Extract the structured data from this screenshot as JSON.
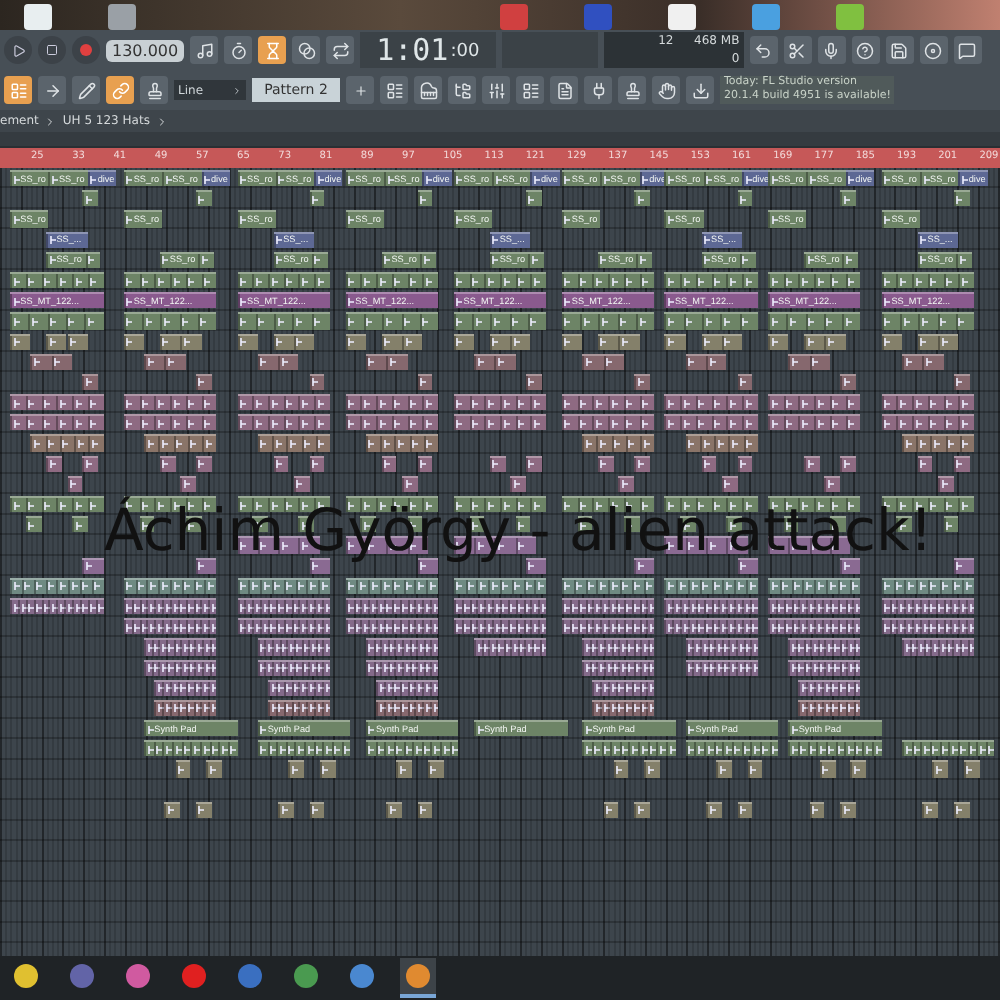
{
  "toolbar": {
    "tempo": "130.000",
    "time_main": "1:01",
    "time_sub": ":00",
    "cpu": "12",
    "memory": "468 MB",
    "polyphony": "0",
    "mode_buttons": [
      {
        "kind": "metronome",
        "selected": false
      },
      {
        "kind": "wait",
        "selected": false
      },
      {
        "kind": "countdown",
        "selected": true
      },
      {
        "kind": "blend",
        "selected": false
      },
      {
        "kind": "loop",
        "selected": false
      }
    ],
    "tool_buttons": [
      {
        "kind": "pattern",
        "selected": true
      },
      {
        "kind": "arrow",
        "selected": false
      },
      {
        "kind": "pencil",
        "selected": false
      },
      {
        "kind": "link",
        "selected": true
      },
      {
        "kind": "stamp",
        "selected": false
      }
    ],
    "snap": "Line",
    "pattern": "Pattern 2",
    "hint": [
      "Today: FL Studio version",
      "20.1.4 build 4951 is available!"
    ]
  },
  "breadcrumb": [
    "ement",
    "UH 5 123 Hats"
  ],
  "ruler": [
    "25",
    "33",
    "41",
    "49",
    "57",
    "65",
    "73",
    "81",
    "89",
    "97",
    "105",
    "113",
    "121",
    "129",
    "137",
    "145",
    "153",
    "161",
    "169",
    "177",
    "185",
    "193",
    "201",
    "209"
  ],
  "lanes": [
    {
      "clips": [
        {
          "label": "SS_ro"
        },
        {
          "label": "SS_ro"
        },
        {
          "label": "dive"
        },
        {
          "label": "SS_ro"
        },
        {
          "label": "SS_ro"
        },
        {
          "label": "dive"
        },
        {
          "label": "SS_ro"
        },
        {
          "label": "SS_ro"
        },
        {
          "label": "dive"
        },
        {
          "label": "SS_ro"
        },
        {
          "label": "SS_ro"
        },
        {
          "label": "dive"
        },
        {
          "label": "SS_ro"
        },
        {
          "label": "SS_ro"
        },
        {
          "label": "dive"
        },
        {
          "label": "SS_ro"
        },
        {
          "label": "SS_ro"
        },
        {
          "label": "dive"
        },
        {
          "label": "SS_ro"
        },
        {
          "label": "SS_ro"
        },
        {
          "label": "dive"
        },
        {
          "label": "SS_ro"
        },
        {
          "label": "SS_ro"
        },
        {
          "label": "dive"
        },
        {
          "label": "SS_ro"
        },
        {
          "label": "SS_ro"
        },
        {
          "label": "dive"
        }
      ]
    },
    {
      "clips": [
        {
          "label": "SS_ro"
        },
        {
          "label": "SS_ro"
        },
        {
          "label": "SS_ro"
        },
        {
          "label": "SS_ro"
        },
        {
          "label": "SS_ro"
        },
        {
          "label": "SS_ro"
        },
        {
          "label": "SS_ro"
        },
        {
          "label": "SS_ro"
        },
        {
          "label": "SS_ro"
        }
      ]
    },
    {
      "clips": [
        {
          "label": "SS_..."
        },
        {
          "label": "SS_..."
        },
        {
          "label": "SS_..."
        },
        {
          "label": "SS_..."
        },
        {
          "label": "SS_..."
        }
      ]
    },
    {
      "clips": [
        {
          "label": "SS_ro"
        },
        {
          "label": "SS_ro"
        },
        {
          "label": "SS_ro"
        },
        {
          "label": "SS_ro"
        },
        {
          "label": "SS_ro"
        },
        {
          "label": "SS_ro"
        },
        {
          "label": "SS_ro"
        },
        {
          "label": "SS_ro"
        },
        {
          "label": "SS_ro"
        }
      ]
    },
    {
      "clips": [
        {
          "label": "SS_MT_122..."
        },
        {
          "label": "SS_MT_122..."
        },
        {
          "label": "SS_MT_122..."
        },
        {
          "label": "SS_MT_122..."
        },
        {
          "label": "SS_MT_122..."
        },
        {
          "label": "SS_MT_122..."
        },
        {
          "label": "SS_MT_122..."
        },
        {
          "label": "SS_MT_122..."
        },
        {
          "label": "SS_MT_122..."
        }
      ]
    },
    {
      "clips": [
        {
          "label": "Synth Pad"
        },
        {
          "label": "Synth Pad"
        },
        {
          "label": "Synth Pad"
        },
        {
          "label": "Synth Pad"
        },
        {
          "label": "Synth Pad"
        },
        {
          "label": "Synth Pad"
        },
        {
          "label": "Synth Pad"
        }
      ]
    }
  ],
  "overlay_title": "Áchim György - alien attack!",
  "taskbar": [
    {
      "kind": "chrome",
      "selected": false
    },
    {
      "kind": "teams",
      "selected": false
    },
    {
      "kind": "drop",
      "selected": false
    },
    {
      "kind": "opera",
      "selected": false
    },
    {
      "kind": "doc",
      "selected": false
    },
    {
      "kind": "sheet",
      "selected": false
    },
    {
      "kind": "globe",
      "selected": false
    },
    {
      "kind": "fl",
      "selected": true
    }
  ]
}
